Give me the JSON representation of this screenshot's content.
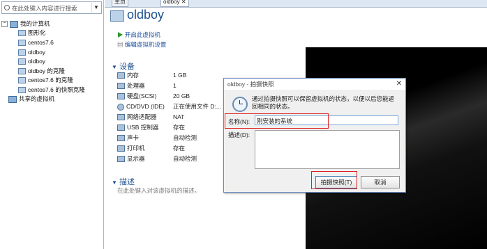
{
  "search": {
    "placeholder": "在此处键入内容进行搜索"
  },
  "tree": {
    "root": "我的计算机",
    "items": [
      "图形化",
      "centos7.6",
      "oldboy",
      "oldboy",
      "oldboy 的克隆",
      "centos7.6 的克隆",
      "centos7.6 的快照克隆"
    ],
    "shared": "共享的虚拟机"
  },
  "tabs": {
    "home": "主页",
    "vm": "oldboy"
  },
  "vm": {
    "title": "oldboy"
  },
  "actions": {
    "start": "开启此虚拟机",
    "edit": "编辑虚拟机设置"
  },
  "devices": {
    "heading": "设备",
    "rows": [
      {
        "name": "内存",
        "value": "1 GB"
      },
      {
        "name": "处理器",
        "value": "1"
      },
      {
        "name": "硬盘(SCSI)",
        "value": "20 GB"
      },
      {
        "name": "CD/DVD (IDE)",
        "value": "正在使用文件 D:..."
      },
      {
        "name": "网络适配器",
        "value": "NAT"
      },
      {
        "name": "USB 控制器",
        "value": "存在"
      },
      {
        "name": "声卡",
        "value": "自动检测"
      },
      {
        "name": "打印机",
        "value": "存在"
      },
      {
        "name": "显示器",
        "value": "自动检测"
      }
    ]
  },
  "description": {
    "heading": "描述",
    "placeholder": "在此处键入对该虚拟机的描述。"
  },
  "dialog": {
    "title": "oldboy - 拍摄快照",
    "close": "✕",
    "text": "通过拍摄快照可以保留虚拟机的状态，以便以后您能返回相同的状态。",
    "name_label": "名称(N):",
    "name_value": "刚安装的系统",
    "desc_label": "描述(D):",
    "ok": "拍摄快照(T)",
    "cancel": "取消"
  },
  "colors": {
    "accent": "#1c4f8e",
    "highlight": "#e02020"
  }
}
